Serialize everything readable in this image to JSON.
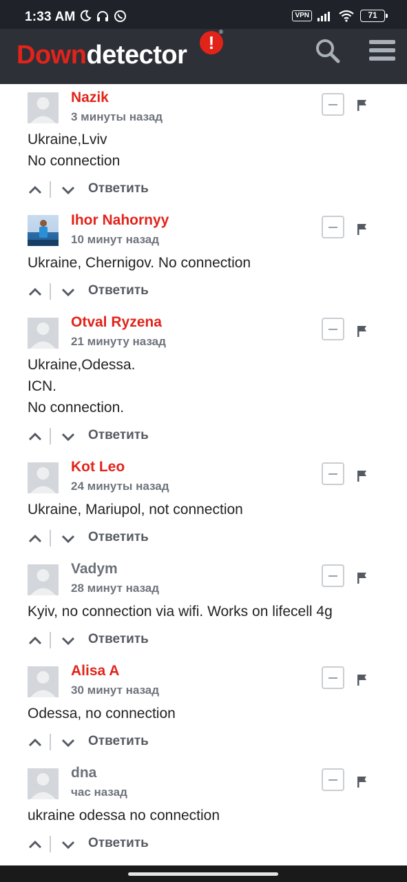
{
  "status_bar": {
    "time": "1:33 AM",
    "vpn": "VPN",
    "battery": "71"
  },
  "header": {
    "brand_down": "Down",
    "brand_detector": "detector",
    "brand_mark": "!"
  },
  "comments": [
    {
      "author": "Nazik",
      "time": "3 минуты назад",
      "lines": [
        "Ukraine,Lviv",
        "No connection"
      ],
      "reply": "Ответить"
    },
    {
      "author": "Ihor Nahornyy",
      "time": "10 минут назад",
      "lines": [
        "Ukraine, Chernigov. No connection"
      ],
      "reply": "Ответить"
    },
    {
      "author": "Otval Ryzena",
      "time": "21 минуту назад",
      "lines": [
        "Ukraine,Odessa.",
        "ICN.",
        "No connection."
      ],
      "reply": "Ответить"
    },
    {
      "author": "Kot Leo",
      "time": "24 минуты назад",
      "lines": [
        "Ukraine, Mariupol, not connection"
      ],
      "reply": "Ответить"
    },
    {
      "author": "Vadym",
      "time": "28 минут назад",
      "lines": [
        "Kyiv, no connection via wifi. Works on lifecell 4g"
      ],
      "reply": "Ответить"
    },
    {
      "author": "Alisa A",
      "time": "30 минут назад",
      "lines": [
        "Odessa, no connection"
      ],
      "reply": "Ответить"
    },
    {
      "author": "dna",
      "time": "час назад",
      "lines": [
        "ukraine odessa no connection"
      ],
      "reply": "Ответить"
    }
  ]
}
